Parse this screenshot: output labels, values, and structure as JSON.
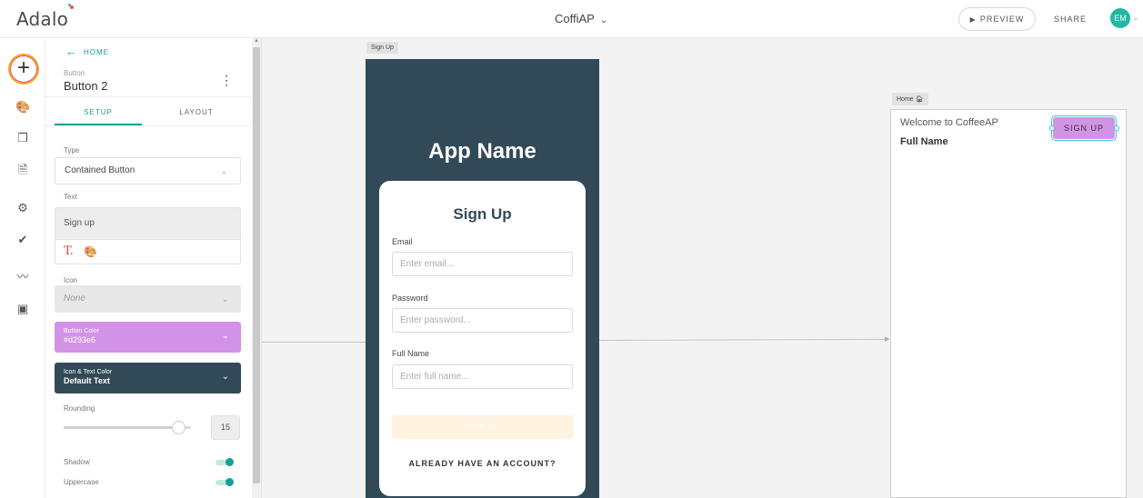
{
  "topbar": {
    "logo": "Adalo",
    "app_title": "CoffiAP",
    "app_title_chevron": "chevron-down-icon",
    "preview_label": "PREVIEW",
    "share_label": "SHARE",
    "avatar_initials": "EM"
  },
  "leftbar": {
    "add_icon": "+",
    "icons": [
      "palette-icon",
      "screens-icon",
      "database-icon",
      "settings-icon",
      "publish-icon",
      "analytics-icon",
      "component-library-icon"
    ]
  },
  "panel": {
    "back_label": "HOME",
    "component_type": "Button",
    "component_name": "Button 2",
    "tabs": [
      {
        "label": "SETUP",
        "active": true
      },
      {
        "label": "LAYOUT",
        "active": false
      }
    ],
    "type_label": "Type",
    "type_value": "Contained Button",
    "text_label": "Text",
    "text_value": "Sign up",
    "icon_label": "Icon",
    "icon_value": "None",
    "button_color_label": "Button Color",
    "button_color_value": "#d293e6",
    "icon_text_color_label": "Icon & Text Color",
    "icon_text_color_value": "Default Text",
    "rounding_label": "Rounding",
    "rounding_value": "15",
    "rounding_fraction": 0.9,
    "shadow_label": "Shadow",
    "shadow_on": true,
    "uppercase_label": "Uppercase",
    "uppercase_on": true
  },
  "canvas": {
    "signup_screen": {
      "tag": "Sign Up",
      "app_name": "App Name",
      "card_title": "Sign Up",
      "email_label": "Email",
      "email_placeholder": "Enter email...",
      "password_label": "Password",
      "password_placeholder": "Enter password...",
      "fullname_label": "Full Name",
      "fullname_placeholder": "Enter full name...",
      "submit_label": "SIGN UP",
      "login_link": "ALREADY HAVE AN ACCOUNT?"
    },
    "home_screen": {
      "tag": "Home",
      "welcome_text": "Welcome to CoffeeAP",
      "fullname_text": "Full Name",
      "signup_button": "SIGN UP"
    }
  },
  "colors": {
    "accent": "#1aa090",
    "button_color": "#d293e6",
    "screen_bg": "#324a57"
  }
}
